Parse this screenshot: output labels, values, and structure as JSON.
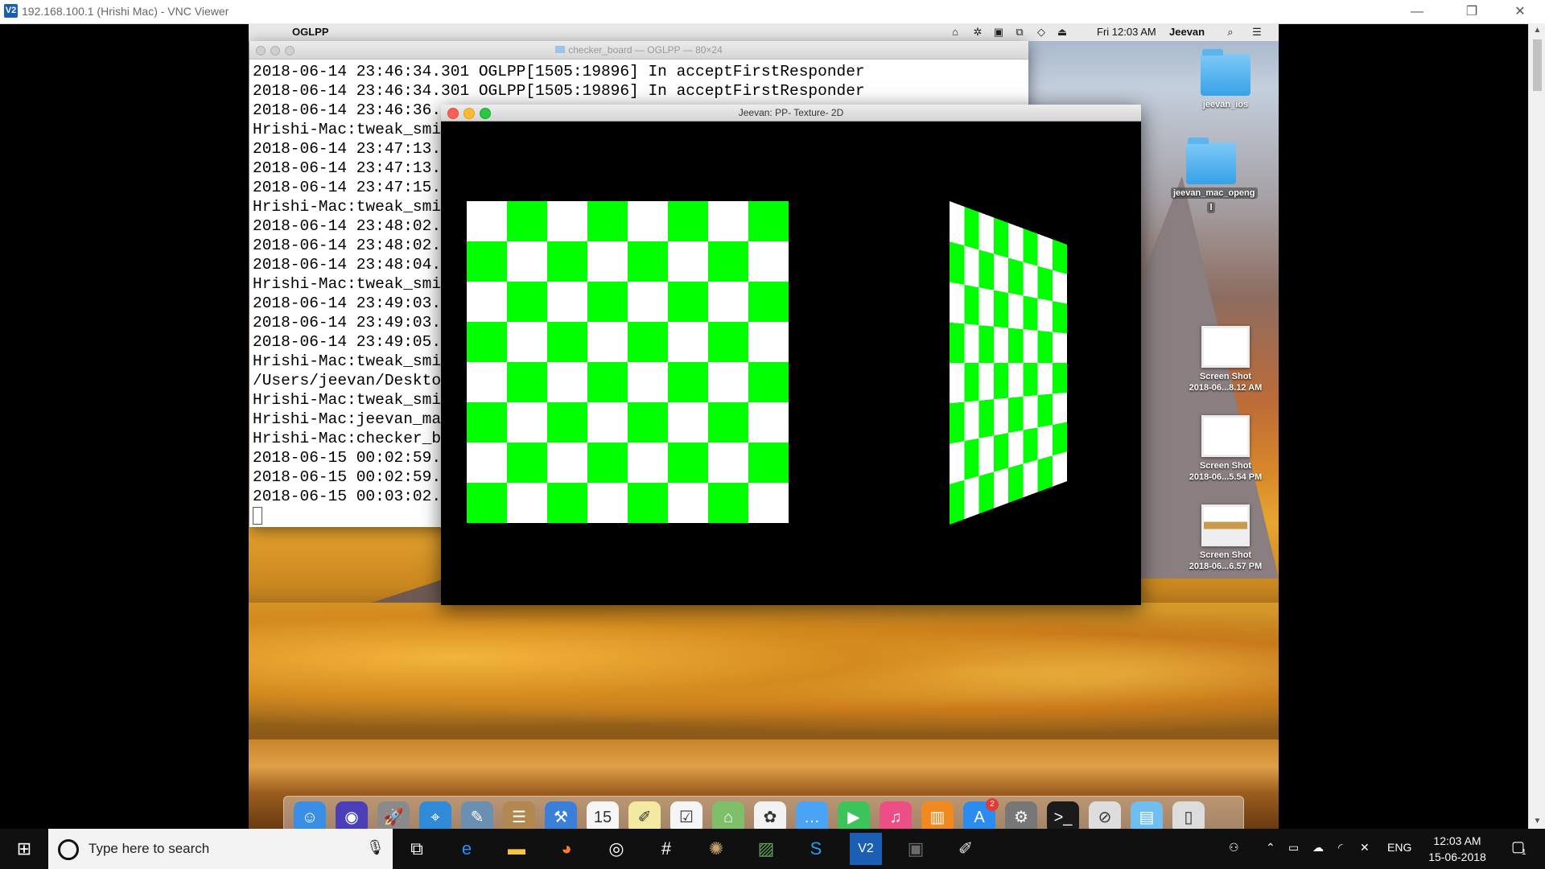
{
  "vnc": {
    "logo": "V2",
    "title": "192.168.100.1 (Hrishi Mac) - VNC Viewer",
    "controls": {
      "minimize": "—",
      "restore": "❐",
      "close": "✕"
    }
  },
  "menubar": {
    "apple": "",
    "app_name": "OGLPP",
    "clock": "Fri 12:03 AM",
    "user": "Jeevan",
    "status_icons": [
      "airplay-icon",
      "gear-icon",
      "finder-icon",
      "display-icon",
      "wifi-icon",
      "eject-icon"
    ],
    "search_icon": "⌕",
    "list_icon": "☰"
  },
  "terminal": {
    "title": "checker_board — OGLPP — 80×24",
    "lines": [
      "2018-06-14 23:46:34.301 OGLPP[1505:19896] In acceptFirstResponder",
      "2018-06-14 23:46:34.301 OGLPP[1505:19896] In acceptFirstResponder",
      "2018-06-14 23:46:36.",
      "Hrishi-Mac:tweak_smi",
      "2018-06-14 23:47:13.",
      "2018-06-14 23:47:13.",
      "2018-06-14 23:47:15.",
      "Hrishi-Mac:tweak_smi",
      "2018-06-14 23:48:02.",
      "2018-06-14 23:48:02.",
      "2018-06-14 23:48:04.",
      "Hrishi-Mac:tweak_smi",
      "2018-06-14 23:49:03.",
      "2018-06-14 23:49:03.",
      "2018-06-14 23:49:05.",
      "Hrishi-Mac:tweak_smi",
      "/Users/jeevan/Deskto",
      "Hrishi-Mac:tweak_smi",
      "Hrishi-Mac:jeevan_ma",
      "Hrishi-Mac:checker_b",
      "2018-06-15 00:02:59.",
      "2018-06-15 00:02:59.",
      "2018-06-15 00:03:02."
    ]
  },
  "glwindow": {
    "title": "Jeevan: PP- Texture- 2D",
    "checker": {
      "rows": 8,
      "cols": 8,
      "color_a": "#ffffff",
      "color_b": "#00ff00"
    }
  },
  "desktop_icons": [
    {
      "label": "jeevan_ios",
      "kind": "folder"
    },
    {
      "label": "jeevan_mac_openg",
      "label2": "l",
      "kind": "folder"
    },
    {
      "label": "Screen Shot",
      "label2": "2018-06...8.12 AM",
      "kind": "shot"
    },
    {
      "label": "Screen Shot",
      "label2": "2018-06...5.54 PM",
      "kind": "shot"
    },
    {
      "label": "Screen Shot",
      "label2": "2018-06...6.57 PM",
      "kind": "shot-img"
    }
  ],
  "dock": {
    "items": [
      {
        "name": "finder-icon",
        "glyph": "☺",
        "color": "#3a8ee6"
      },
      {
        "name": "siri-icon",
        "glyph": "◉",
        "color": "#4a3fb8"
      },
      {
        "name": "launchpad-icon",
        "glyph": "🚀",
        "color": "#8a8a8a"
      },
      {
        "name": "safari-icon",
        "glyph": "⌖",
        "color": "#2f8ad8"
      },
      {
        "name": "preview-icon",
        "glyph": "✎",
        "color": "#6a8fb0"
      },
      {
        "name": "contacts-icon",
        "glyph": "☰",
        "color": "#b08850"
      },
      {
        "name": "xcode-icon",
        "glyph": "⚒",
        "color": "#3a7fd8"
      },
      {
        "name": "calendar-icon",
        "glyph": "15",
        "color": "#f5f5f5"
      },
      {
        "name": "notes-icon",
        "glyph": "✐",
        "color": "#f4e9a0"
      },
      {
        "name": "reminders-icon",
        "glyph": "☑",
        "color": "#f5f5f5"
      },
      {
        "name": "maps-icon",
        "glyph": "⌂",
        "color": "#7fbf6a"
      },
      {
        "name": "photos-icon",
        "glyph": "✿",
        "color": "#f2f2f2"
      },
      {
        "name": "messages-icon",
        "glyph": "…",
        "color": "#4aa3f5"
      },
      {
        "name": "facetime-icon",
        "glyph": "▶",
        "color": "#3cc45a"
      },
      {
        "name": "itunes-icon",
        "glyph": "♫",
        "color": "#ec4f86"
      },
      {
        "name": "ibooks-icon",
        "glyph": "▥",
        "color": "#f08a1e"
      },
      {
        "name": "appstore-icon",
        "glyph": "A",
        "color": "#2a8bf0",
        "badge": "2"
      },
      {
        "name": "system-preferences-icon",
        "glyph": "⚙",
        "color": "#777777"
      },
      {
        "name": "terminal-icon",
        "glyph": ">_",
        "color": "#1b1b1b"
      },
      {
        "name": "blocked-app-icon",
        "glyph": "⊘",
        "color": "#dddddd"
      },
      {
        "name": "downloads-folder-icon",
        "glyph": "▤",
        "color": "#6fbef0"
      },
      {
        "name": "trash-icon",
        "glyph": "▯",
        "color": "#dcdcdc"
      }
    ]
  },
  "taskbar": {
    "search_placeholder": "Type here to search",
    "apps": [
      {
        "name": "task-view-icon",
        "glyph": "⧉"
      },
      {
        "name": "edge-icon",
        "glyph": "e"
      },
      {
        "name": "file-explorer-icon",
        "glyph": "▬"
      },
      {
        "name": "firefox-icon",
        "glyph": "◕"
      },
      {
        "name": "chrome-like-icon",
        "glyph": "◎"
      },
      {
        "name": "slack-icon",
        "glyph": "#"
      },
      {
        "name": "settings-app-icon",
        "glyph": "✺"
      },
      {
        "name": "image-editor-icon",
        "glyph": "▨"
      },
      {
        "name": "skype-icon",
        "glyph": "S"
      },
      {
        "name": "vnc-viewer-icon",
        "glyph": "V2"
      },
      {
        "name": "paint-tool-icon",
        "glyph": "▣"
      },
      {
        "name": "paint-icon",
        "glyph": "✐"
      }
    ],
    "tray": {
      "lang": "ENG",
      "time": "12:03 AM",
      "date": "15-06-2018",
      "notif_count": "1"
    }
  }
}
